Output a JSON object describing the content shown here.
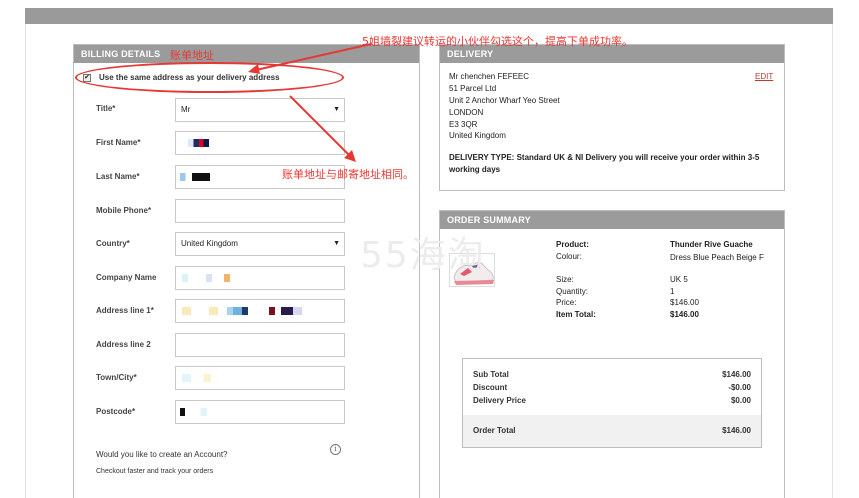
{
  "billing": {
    "header": "BILLING DETAILS",
    "same_address_label": "Use the same address as your delivery address",
    "fields": {
      "title_label": "Title*",
      "title_value": "Mr",
      "first_name_label": "First Name*",
      "last_name_label": "Last Name*",
      "mobile_label": "Mobile Phone*",
      "country_label": "Country*",
      "country_value": "United Kingdom",
      "company_label": "Company Name",
      "address1_label": "Address line 1*",
      "address2_label": "Address line 2",
      "town_label": "Town/City*",
      "postcode_label": "Postcode*"
    },
    "create_account_q": "Would you like to create an Account?",
    "create_account_sub": "Checkout faster and track your orders",
    "info_glyph": "i"
  },
  "delivery": {
    "header": "DELIVERY",
    "edit_label": "EDIT",
    "address_lines": [
      "Mr chenchen FEFEEC",
      "51 Parcel Ltd",
      "Unit 2 Anchor Wharf Yeo Street",
      "LONDON",
      "E3 3QR",
      "United Kingdom"
    ],
    "delivery_type": "DELIVERY TYPE: Standard UK & NI Delivery you will receive your order within 3-5 working days"
  },
  "order_summary": {
    "header": "ORDER SUMMARY",
    "product_label": "Product:",
    "product_value": "Thunder Rive Guache",
    "colour_label": "Colour:",
    "colour_value": "Dress Blue Peach Beige F",
    "size_label": "Size:",
    "size_value": "UK 5",
    "quantity_label": "Quantity:",
    "quantity_value": "1",
    "price_label": "Price:",
    "price_value": "$146.00",
    "item_total_label": "Item Total:",
    "item_total_value": "$146.00",
    "totals": {
      "sub_total_label": "Sub Total",
      "sub_total_value": "$146.00",
      "discount_label": "Discount",
      "discount_value": "-$0.00",
      "delivery_price_label": "Delivery Price",
      "delivery_price_value": "$0.00",
      "order_total_label": "Order Total",
      "order_total_value": "$146.00"
    }
  },
  "annotations": {
    "billing_address": "账单地址",
    "tip_top": "5姐墙裂建议转运的小伙伴勾选这个，提高下单成功率。",
    "same_as_postal": "账单地址与邮寄地址相同。",
    "watermark": "55海淘"
  },
  "colors": {
    "accent_red": "#e53935",
    "header_grey": "#9b9b9b"
  }
}
